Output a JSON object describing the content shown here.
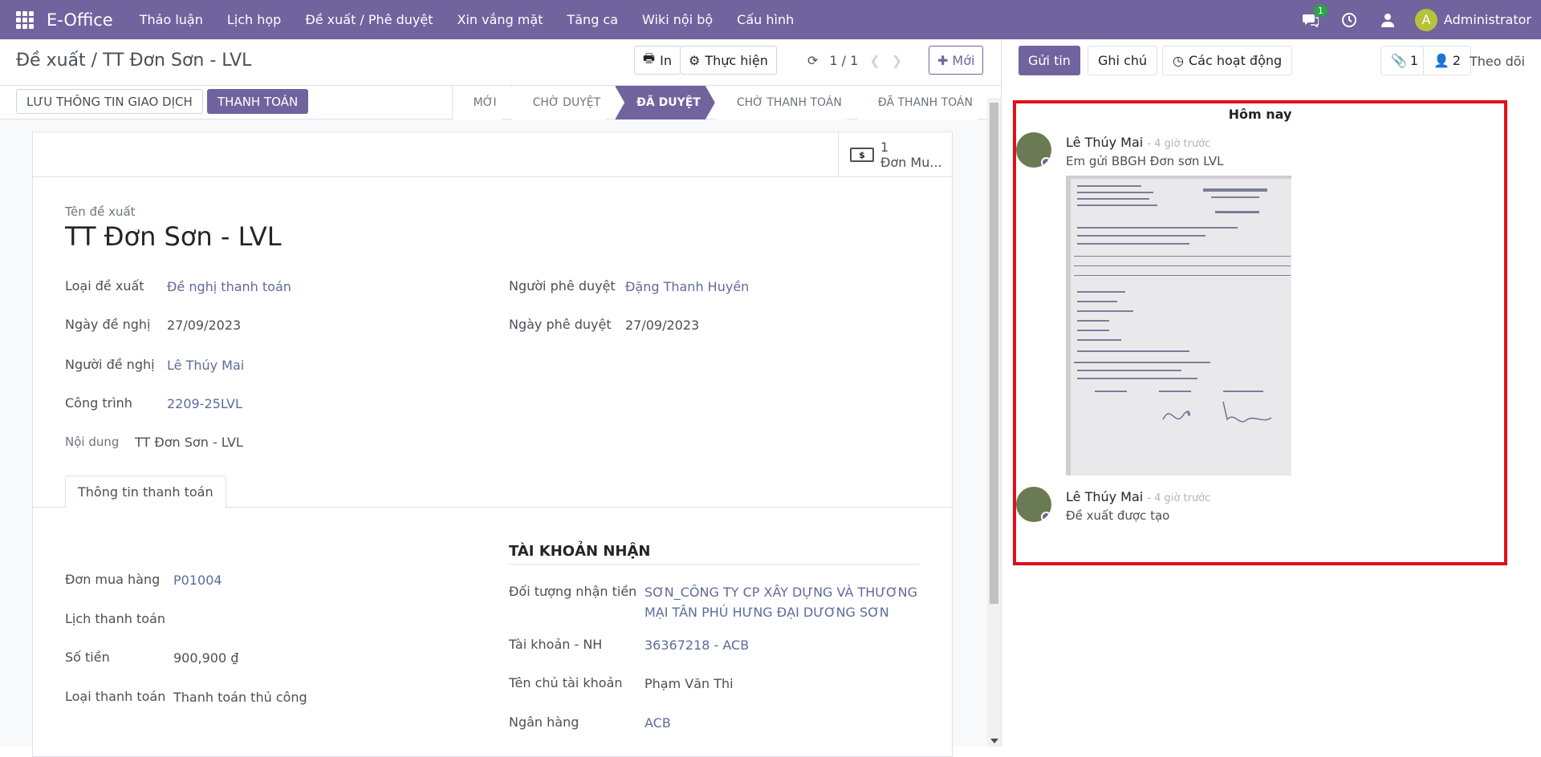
{
  "topbar": {
    "brand": "E-Office",
    "menu": [
      "Thảo luận",
      "Lịch họp",
      "Đề xuất / Phê duyệt",
      "Xin vắng mặt",
      "Tăng ca",
      "Wiki nội bộ",
      "Cấu hình"
    ],
    "chat_badge": "1",
    "user_initial": "A",
    "user_name": "Administrator"
  },
  "control": {
    "breadcrumb": "Đề xuất / TT Đơn Sơn - LVL",
    "print_label": "In",
    "action_label": "Thực hiện",
    "pager": "1 / 1",
    "new_label": "Mới"
  },
  "statusbar": {
    "save_label": "LƯU THÔNG TIN GIAO DỊCH",
    "pay_label": "THANH TOÁN",
    "stages": [
      "MỚI",
      "CHỜ DUYỆT",
      "ĐÃ DUYỆT",
      "CHỜ THANH TOÁN",
      "ĐÃ THANH TOÁN"
    ],
    "active_stage": "ĐÃ DUYỆT"
  },
  "smart_button": {
    "count": "1",
    "label": "Đơn Mu..."
  },
  "form": {
    "name_label": "Tên đề xuất",
    "name_value": "TT Đơn Sơn - LVL",
    "type_label": "Loại đề xuất",
    "type_value": "Đề nghị thanh toán",
    "date_label": "Ngày đề nghị",
    "date_value": "27/09/2023",
    "requester_label": "Người đề nghị",
    "requester_value": "Lê Thúy Mai",
    "project_label": "Công trình",
    "project_value": "2209-25LVL",
    "approver_label": "Người phê duyệt",
    "approver_value": "Đặng Thanh Huyền",
    "approve_date_label": "Ngày phê duyệt",
    "approve_date_value": "27/09/2023",
    "content_label": "Nội dung",
    "content_value": "TT Đơn Sơn - LVL",
    "tab_label": "Thông tin thanh toán",
    "po_label": "Đơn mua hàng",
    "po_value": "P01004",
    "schedule_label": "Lịch thanh toán",
    "amount_label": "Số tiền",
    "amount_value": "900,900 ₫",
    "pay_type_label": "Loại thanh toán",
    "pay_type_value": "Thanh toán thủ công",
    "receive_section": "TÀI KHOẢN NHẬN",
    "recipient_label": "Đối tượng nhận tiền",
    "recipient_line1": "SƠN_CÔNG TY CP XÂY DỰNG VÀ THƯƠNG",
    "recipient_line2": "MẠI TÂN PHÚ HƯNG ĐẠI DƯƠNG SƠN",
    "account_label": "Tài khoản - NH",
    "account_value": "36367218 - ACB",
    "holder_label": "Tên chủ tài khoản",
    "holder_value": "Phạm Văn Thi",
    "bank_label": "Ngân hàng",
    "bank_value": "ACB"
  },
  "chatter": {
    "send_label": "Gửi tin",
    "note_label": "Ghi chú",
    "activity_label": "Các hoạt động",
    "attachments_count": "1",
    "followers_count": "2",
    "follow_label": "Theo dõi",
    "today_label": "Hôm nay",
    "messages": [
      {
        "author": "Lê Thúy Mai",
        "time": "- 4 giờ trước",
        "body": "Em gửi BBGH Đơn sơn LVL"
      },
      {
        "author": "Lê Thúy Mai",
        "time": "- 4 giờ trước",
        "body": "Đề xuất được tạo"
      }
    ]
  }
}
